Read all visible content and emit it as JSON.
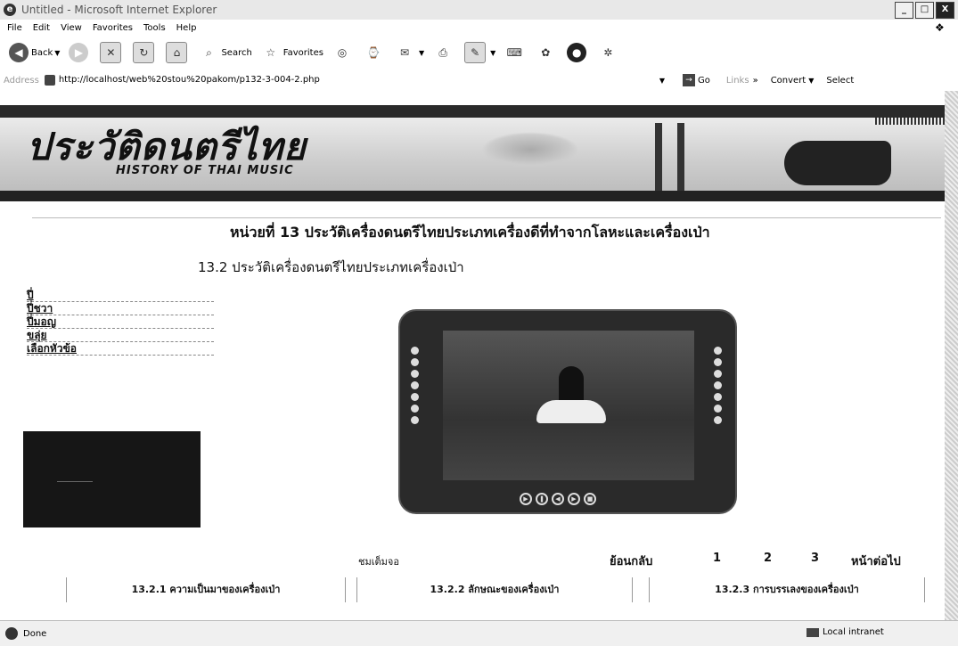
{
  "window": {
    "title": "Untitled - Microsoft Internet Explorer",
    "buttons": [
      "_",
      "□",
      "X"
    ]
  },
  "menu": [
    "File",
    "Edit",
    "View",
    "Favorites",
    "Tools",
    "Help"
  ],
  "toolbar": {
    "back_label": "Back",
    "search_label": "Search",
    "favorites_label": "Favorites"
  },
  "address": {
    "label": "Address",
    "url": "http://localhost/web%20stou%20pakom/p132-3-004-2.php",
    "go_label": "Go",
    "links_label": "Links",
    "convert_label": "Convert",
    "select_label": "Select"
  },
  "banner": {
    "thai_title": "ประวัติดนตรีไทย",
    "eng_title": "HISTORY OF THAI MUSIC"
  },
  "page": {
    "unit_heading": "หน่วยที่ 13 ประวัติเครื่องดนตรีไทยประเภทเครื่องดีที่ทำจากโลหะและเครื่องเป่า",
    "sub_heading": "13.2 ประวัติเครื่องดนตรีไทยประเภทเครื่องเป่า"
  },
  "left_menu": [
    "ปี่",
    "ปี่ชวา",
    "ปี่มอญ",
    "ขลุ่ย",
    "เลือกหัวข้อ"
  ],
  "nav": {
    "fullscreen": "ชมเต็มจอ",
    "back": "ย้อนกลับ",
    "pages": [
      "1",
      "2",
      "3"
    ],
    "next": "หน้าต่อไป"
  },
  "sections": [
    "13.2.1 ความเป็นมาของเครื่องเป่า",
    "13.2.2 ลักษณะของเครื่องเป่า",
    "13.2.3 การบรรเลงของเครื่องเป่า"
  ],
  "status": {
    "left": "Done",
    "zone": "Local intranet"
  }
}
